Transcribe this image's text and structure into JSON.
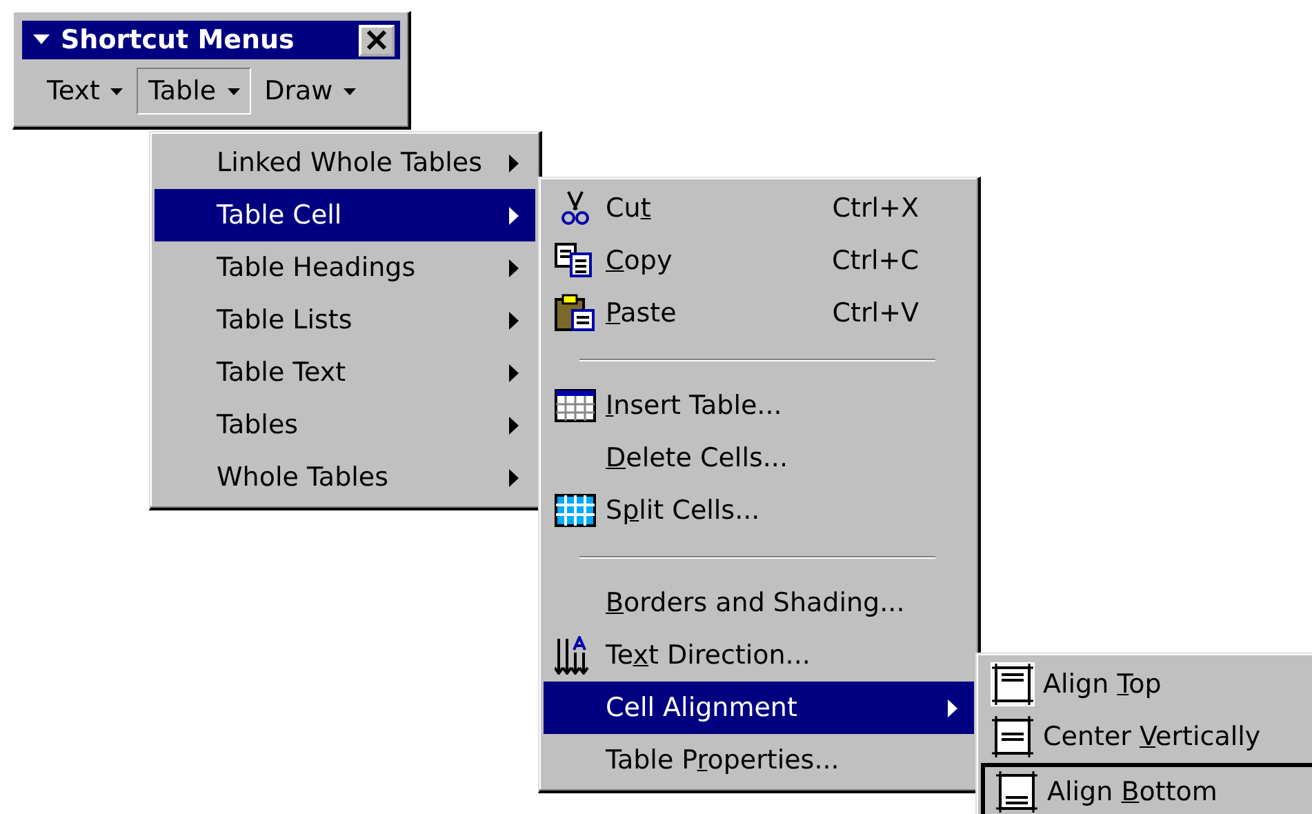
{
  "toolbar": {
    "title": "Shortcut Menus",
    "buttons": [
      {
        "label": "Text",
        "selected": false
      },
      {
        "label": "Table",
        "selected": true
      },
      {
        "label": "Draw",
        "selected": false
      }
    ]
  },
  "menus": [
    {
      "items": [
        {
          "kind": "item",
          "text_before": "Linked Whole Tables",
          "submenu": true,
          "selected": false
        },
        {
          "kind": "item",
          "text_before": "Table Cell",
          "submenu": true,
          "selected": true
        },
        {
          "kind": "item",
          "text_before": "Table Headings",
          "submenu": true,
          "selected": false
        },
        {
          "kind": "item",
          "text_before": "Table Lists",
          "submenu": true,
          "selected": false
        },
        {
          "kind": "item",
          "text_before": "Table Text",
          "submenu": true,
          "selected": false
        },
        {
          "kind": "item",
          "text_before": "Tables",
          "submenu": true,
          "selected": false
        },
        {
          "kind": "item",
          "text_before": "Whole Tables",
          "submenu": true,
          "selected": false
        }
      ]
    },
    {
      "items": [
        {
          "kind": "item",
          "text_before": "Cu",
          "access_key": "t",
          "shortcut": "Ctrl+X",
          "selected": false
        },
        {
          "kind": "item",
          "access_key": "C",
          "text_after": "opy",
          "shortcut": "Ctrl+C",
          "selected": false
        },
        {
          "kind": "item",
          "access_key": "P",
          "text_after": "aste",
          "shortcut": "Ctrl+V",
          "selected": false
        },
        {
          "kind": "separator"
        },
        {
          "kind": "item",
          "access_key": "I",
          "text_after": "nsert Table...",
          "selected": false
        },
        {
          "kind": "item",
          "access_key": "D",
          "text_after": "elete Cells...",
          "selected": false
        },
        {
          "kind": "item",
          "text_before": "S",
          "access_key": "p",
          "text_after": "lit Cells...",
          "selected": false
        },
        {
          "kind": "separator"
        },
        {
          "kind": "item",
          "access_key": "B",
          "text_after": "orders and Shading...",
          "selected": false
        },
        {
          "kind": "item",
          "text_before": "Te",
          "access_key": "x",
          "text_after": "t Direction...",
          "selected": false
        },
        {
          "kind": "item",
          "text_before": "Cell Alignment",
          "submenu": true,
          "selected": true
        },
        {
          "kind": "item",
          "text_before": "Table P",
          "access_key": "r",
          "text_after": "operties...",
          "selected": false
        }
      ]
    },
    {
      "items": [
        {
          "kind": "item",
          "text_before": "Align ",
          "access_key": "T",
          "text_after": "op",
          "checked": true,
          "selected": false
        },
        {
          "kind": "item",
          "text_before": "Center ",
          "access_key": "V",
          "text_after": "ertically",
          "checked": false,
          "selected": false
        },
        {
          "kind": "item",
          "text_before": "Align ",
          "access_key": "B",
          "text_after": "ottom",
          "checked": false,
          "selected": true
        }
      ]
    }
  ]
}
